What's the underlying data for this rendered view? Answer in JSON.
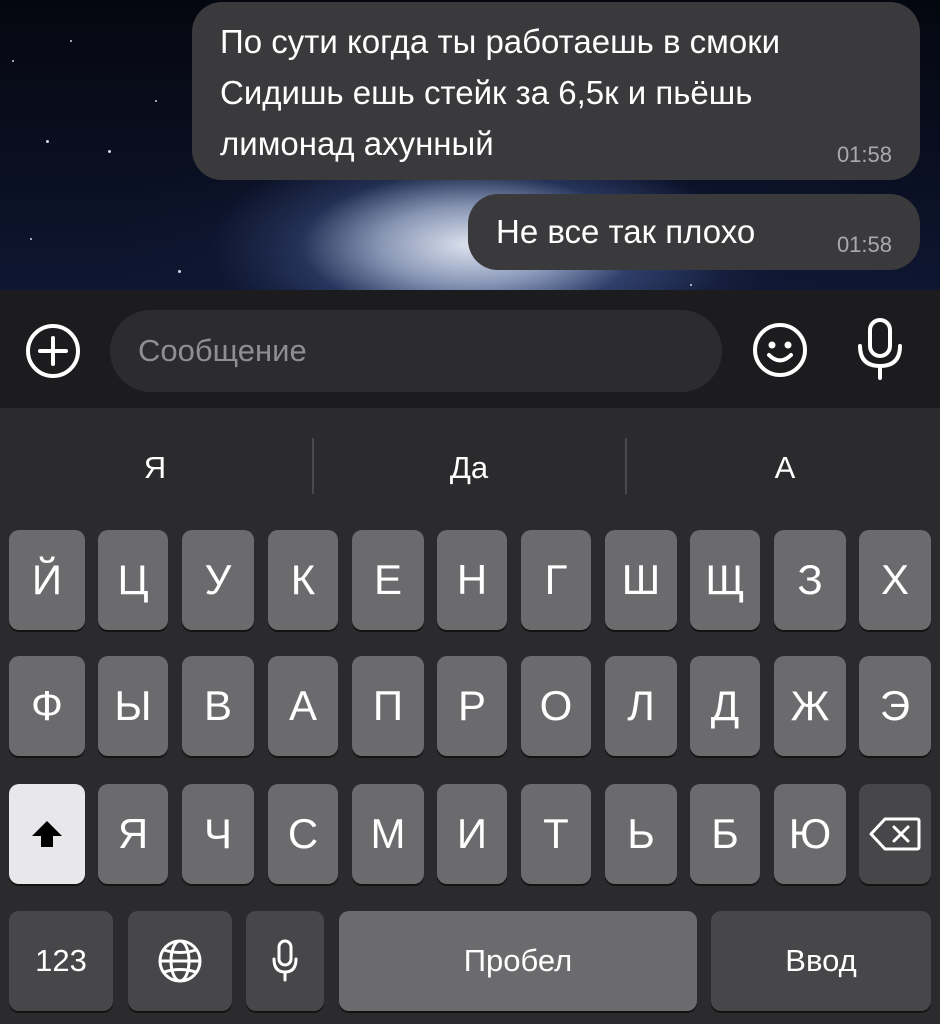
{
  "chat": {
    "messages": [
      {
        "text": "По сути когда ты работаешь в смоки\nСидишь ешь стейк за 6,5к и пьёшь\nлимонад ахунный",
        "time": "01:58"
      },
      {
        "text": "Не все так плохо",
        "time": "01:58"
      }
    ]
  },
  "input": {
    "placeholder": "Сообщение",
    "icons": {
      "attach": "plus-circle-icon",
      "emoji": "smiley-icon",
      "voice": "microphone-icon"
    }
  },
  "keyboard": {
    "suggestions": [
      "Я",
      "Да",
      "А"
    ],
    "row1": [
      "Й",
      "Ц",
      "У",
      "К",
      "Е",
      "Н",
      "Г",
      "Ш",
      "Щ",
      "З",
      "Х"
    ],
    "row2": [
      "Ф",
      "Ы",
      "В",
      "А",
      "П",
      "Р",
      "О",
      "Л",
      "Д",
      "Ж",
      "Э"
    ],
    "row3": [
      "Я",
      "Ч",
      "С",
      "М",
      "И",
      "Т",
      "Ь",
      "Б",
      "Ю"
    ],
    "numbers_label": "123",
    "space_label": "Пробел",
    "return_label": "Ввод",
    "icons": {
      "shift": "shift-icon",
      "delete": "backspace-icon",
      "globe": "globe-icon",
      "dictation": "microphone-icon"
    }
  }
}
